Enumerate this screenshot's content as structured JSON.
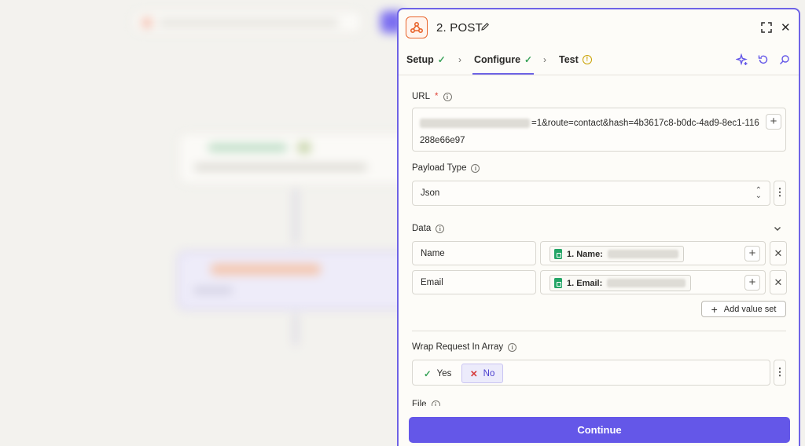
{
  "panel": {
    "title": "2. POST",
    "app_icon": "webhook-icon",
    "accent": "#6457e8"
  },
  "tabs": [
    {
      "label": "Setup",
      "status": "complete"
    },
    {
      "label": "Configure",
      "status": "complete"
    },
    {
      "label": "Test",
      "status": "warning"
    }
  ],
  "form": {
    "url": {
      "label": "URL",
      "required_mark": "*",
      "value": "=1&route=contact&hash=4b3617c8-b0dc-4ad9-8ec1-116288e66e97"
    },
    "payload_type": {
      "label": "Payload Type",
      "value": "Json"
    },
    "data": {
      "label": "Data",
      "rows": [
        {
          "key": "Name",
          "tag": "1. Name:"
        },
        {
          "key": "Email",
          "tag": "1. Email:"
        }
      ],
      "add_label": "Add value set"
    },
    "wrap": {
      "label": "Wrap Request In Array",
      "yes": "Yes",
      "no": "No",
      "selected": "No"
    },
    "file": {
      "label": "File"
    }
  },
  "continue_label": "Continue"
}
